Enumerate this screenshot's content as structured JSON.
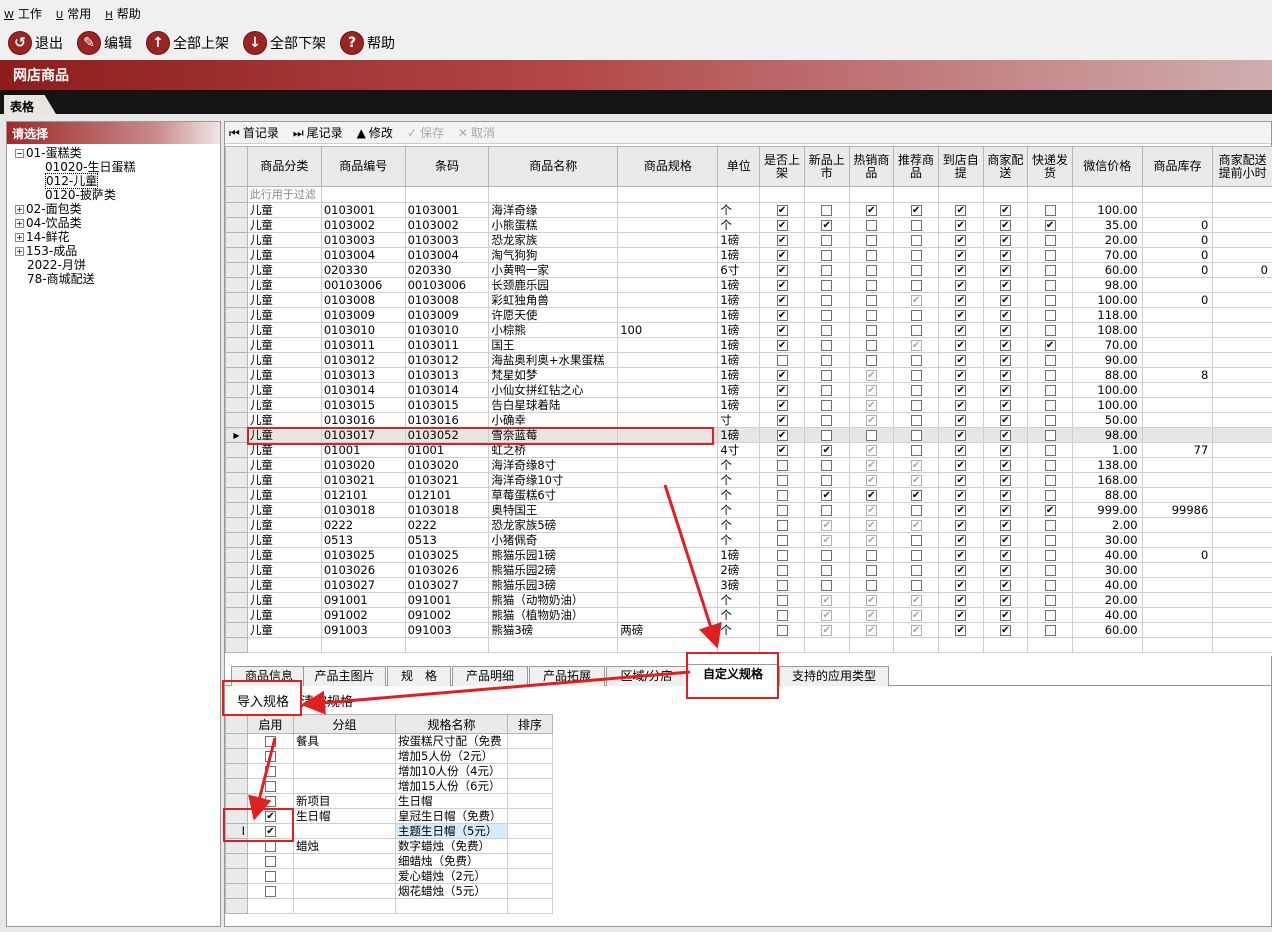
{
  "menu": [
    {
      "acc": "W",
      "label": "工作"
    },
    {
      "acc": "U",
      "label": "常用"
    },
    {
      "acc": "H",
      "label": "帮助"
    }
  ],
  "toolbar": [
    {
      "label": "退出",
      "icon": "exit-icon",
      "glyph": "↺"
    },
    {
      "label": "编辑",
      "icon": "edit-icon",
      "glyph": "✎"
    },
    {
      "label": "全部上架",
      "icon": "arrow-up-icon",
      "glyph": "↑"
    },
    {
      "label": "全部下架",
      "icon": "arrow-down-icon",
      "glyph": "↓"
    },
    {
      "label": "帮助",
      "icon": "help-icon",
      "glyph": "?"
    }
  ],
  "window_title": "网店商品",
  "tab_label": "表格",
  "left": {
    "header": "请选择",
    "tree": [
      {
        "label": "01-蛋糕类",
        "level": 0,
        "toggle": "−"
      },
      {
        "label": "01020-生日蛋糕",
        "level": 2
      },
      {
        "label": "012-儿童",
        "level": 2,
        "selected": true
      },
      {
        "label": "0120-披萨类",
        "level": 2
      },
      {
        "label": "02-面包类",
        "level": 0,
        "toggle": "+"
      },
      {
        "label": "04-饮品类",
        "level": 0,
        "toggle": "+"
      },
      {
        "label": "14-鲜花",
        "level": 0,
        "toggle": "+"
      },
      {
        "label": "153-成品",
        "level": 0,
        "toggle": "+"
      },
      {
        "label": "2022-月饼",
        "level": 1
      },
      {
        "label": "78-商城配送",
        "level": 1
      }
    ]
  },
  "nav": [
    {
      "label": "首记录",
      "glyph": "⏮",
      "enabled": true
    },
    {
      "label": "尾记录",
      "glyph": "⏭",
      "enabled": true
    },
    {
      "label": "修改",
      "glyph": "▲",
      "enabled": true
    },
    {
      "label": "保存",
      "glyph": "✓",
      "enabled": false
    },
    {
      "label": "取消",
      "glyph": "✕",
      "enabled": false
    }
  ],
  "grid": {
    "columns": [
      "商品分类",
      "商品编号",
      "条码",
      "商品名称",
      "商品规格",
      "单位",
      "是否上架",
      "新品上市",
      "热销商品",
      "推荐商品",
      "到店自提",
      "商家配送",
      "快递发货",
      "微信价格",
      "商品库存",
      "商家配送提前小时"
    ],
    "filter_text": "此行用于过滤",
    "rows": [
      [
        "儿童",
        "0103001",
        "0103001",
        "海洋奇缘",
        "",
        "个",
        1,
        0,
        1,
        1,
        1,
        1,
        0,
        "100.00",
        "",
        ""
      ],
      [
        "儿童",
        "0103002",
        "0103002",
        "小熊蛋糕",
        "",
        "个",
        1,
        1,
        0,
        0,
        1,
        1,
        1,
        "35.00",
        "0",
        ""
      ],
      [
        "儿童",
        "0103003",
        "0103003",
        "恐龙家族",
        "",
        "1磅",
        1,
        0,
        0,
        0,
        1,
        1,
        0,
        "20.00",
        "0",
        ""
      ],
      [
        "儿童",
        "0103004",
        "0103004",
        "淘气狗狗",
        "",
        "1磅",
        1,
        0,
        0,
        0,
        1,
        1,
        0,
        "70.00",
        "0",
        ""
      ],
      [
        "儿童",
        "020330",
        "020330",
        "小黄鸭一家",
        "",
        "6寸",
        1,
        0,
        0,
        0,
        1,
        1,
        0,
        "60.00",
        "0",
        "0"
      ],
      [
        "儿童",
        "00103006",
        "00103006",
        "长颈鹿乐园",
        "",
        "1磅",
        1,
        0,
        0,
        0,
        1,
        1,
        0,
        "98.00",
        "",
        ""
      ],
      [
        "儿童",
        "0103008",
        "0103008",
        "彩虹独角兽",
        "",
        "1磅",
        1,
        0,
        0,
        2,
        1,
        1,
        0,
        "100.00",
        "0",
        ""
      ],
      [
        "儿童",
        "0103009",
        "0103009",
        "许愿天使",
        "",
        "1磅",
        1,
        0,
        0,
        0,
        1,
        1,
        0,
        "118.00",
        "",
        ""
      ],
      [
        "儿童",
        "0103010",
        "0103010",
        "小棕熊",
        "100",
        "1磅",
        1,
        0,
        0,
        0,
        1,
        1,
        0,
        "108.00",
        "",
        ""
      ],
      [
        "儿童",
        "0103011",
        "0103011",
        "国王",
        "",
        "1磅",
        1,
        0,
        0,
        2,
        1,
        1,
        1,
        "70.00",
        "",
        ""
      ],
      [
        "儿童",
        "0103012",
        "0103012",
        "海盐奥利奥+水果蛋糕",
        "",
        "1磅",
        0,
        0,
        0,
        0,
        1,
        1,
        0,
        "90.00",
        "",
        ""
      ],
      [
        "儿童",
        "0103013",
        "0103013",
        "梵星如梦",
        "",
        "1磅",
        1,
        0,
        2,
        0,
        1,
        1,
        0,
        "88.00",
        "8",
        ""
      ],
      [
        "儿童",
        "0103014",
        "0103014",
        "小仙女拼红钻之心",
        "",
        "1磅",
        1,
        0,
        2,
        0,
        1,
        1,
        0,
        "100.00",
        "",
        ""
      ],
      [
        "儿童",
        "0103015",
        "0103015",
        "告白星球着陆",
        "",
        "1磅",
        1,
        0,
        2,
        0,
        1,
        1,
        0,
        "100.00",
        "",
        ""
      ],
      [
        "儿童",
        "0103016",
        "0103016",
        "小确幸",
        "",
        "寸",
        1,
        0,
        2,
        0,
        1,
        1,
        0,
        "50.00",
        "",
        ""
      ],
      [
        "儿童",
        "0103017",
        "0103052",
        "雪奈蓝莓",
        "",
        "1磅",
        1,
        0,
        0,
        0,
        1,
        1,
        0,
        "98.00",
        "",
        ""
      ],
      [
        "儿童",
        "01001",
        "01001",
        "虹之桥",
        "",
        "4寸",
        1,
        1,
        2,
        0,
        1,
        1,
        0,
        "1.00",
        "77",
        ""
      ],
      [
        "儿童",
        "0103020",
        "0103020",
        "海洋奇缘8寸",
        "",
        "个",
        0,
        0,
        2,
        2,
        1,
        1,
        0,
        "138.00",
        "",
        ""
      ],
      [
        "儿童",
        "0103021",
        "0103021",
        "海洋奇缘10寸",
        "",
        "个",
        0,
        0,
        2,
        2,
        1,
        1,
        0,
        "168.00",
        "",
        ""
      ],
      [
        "儿童",
        "012101",
        "012101",
        "草莓蛋糕6寸",
        "",
        "个",
        0,
        1,
        1,
        1,
        1,
        1,
        0,
        "88.00",
        "",
        ""
      ],
      [
        "儿童",
        "0103018",
        "0103018",
        "奥特国王",
        "",
        "个",
        0,
        0,
        2,
        0,
        1,
        1,
        1,
        "999.00",
        "99986",
        ""
      ],
      [
        "儿童",
        "0222",
        "0222",
        "恐龙家族5磅",
        "",
        "个",
        0,
        2,
        2,
        2,
        1,
        1,
        0,
        "2.00",
        "",
        ""
      ],
      [
        "儿童",
        "0513",
        "0513",
        "小猪佩奇",
        "",
        "个",
        0,
        2,
        2,
        0,
        1,
        1,
        0,
        "30.00",
        "",
        ""
      ],
      [
        "儿童",
        "0103025",
        "0103025",
        "熊猫乐园1磅",
        "",
        "1磅",
        0,
        0,
        0,
        0,
        1,
        1,
        0,
        "40.00",
        "0",
        ""
      ],
      [
        "儿童",
        "0103026",
        "0103026",
        "熊猫乐园2磅",
        "",
        "2磅",
        0,
        0,
        0,
        0,
        1,
        1,
        0,
        "30.00",
        "",
        ""
      ],
      [
        "儿童",
        "0103027",
        "0103027",
        "熊猫乐园3磅",
        "",
        "3磅",
        0,
        0,
        0,
        0,
        1,
        1,
        0,
        "40.00",
        "",
        ""
      ],
      [
        "儿童",
        "091001",
        "091001",
        "熊猫（动物奶油）",
        "",
        "个",
        0,
        2,
        2,
        2,
        1,
        1,
        0,
        "20.00",
        "",
        ""
      ],
      [
        "儿童",
        "091002",
        "091002",
        "熊猫（植物奶油）",
        "",
        "个",
        0,
        2,
        2,
        2,
        1,
        1,
        0,
        "40.00",
        "",
        ""
      ],
      [
        "儿童",
        "091003",
        "091003",
        "熊猫3磅",
        "两磅",
        "个",
        0,
        2,
        2,
        2,
        1,
        1,
        0,
        "60.00",
        "",
        ""
      ]
    ],
    "selected_row": 15
  },
  "bottom_tabs": [
    "商品信息",
    "产品主图片",
    "规　格",
    "产品明细",
    "产品拓展",
    "区域/分店",
    "自定义规格",
    "支持的应用类型"
  ],
  "active_tab": 6,
  "sub_toolbar": {
    "import": "导入规格",
    "clear": "清空规格"
  },
  "spec": {
    "columns": [
      "启用",
      "分组",
      "规格名称",
      "排序"
    ],
    "rows": [
      {
        "on": false,
        "group": "餐具",
        "name": "按蛋糕尺寸配（免费"
      },
      {
        "on": false,
        "group": "",
        "name": "增加5人份（2元）"
      },
      {
        "on": false,
        "group": "",
        "name": "增加10人份（4元）"
      },
      {
        "on": false,
        "group": "",
        "name": "增加15人份（6元）"
      },
      {
        "on": false,
        "group": "新项目",
        "name": "生日帽"
      },
      {
        "on": true,
        "group": "生日帽",
        "name": "皇冠生日帽（免费）"
      },
      {
        "on": true,
        "group": "",
        "name": "主题生日帽（5元）",
        "current": true
      },
      {
        "on": false,
        "group": "蜡烛",
        "name": "数字蜡烛（免费）"
      },
      {
        "on": false,
        "group": "",
        "name": "细蜡烛（免费）"
      },
      {
        "on": false,
        "group": "",
        "name": "爱心蜡烛（2元）"
      },
      {
        "on": false,
        "group": "",
        "name": "烟花蜡烛（5元）"
      }
    ],
    "cursor_glyph": "I"
  },
  "colors": {
    "brand": "#9a2424",
    "highlight": "#e02020"
  }
}
